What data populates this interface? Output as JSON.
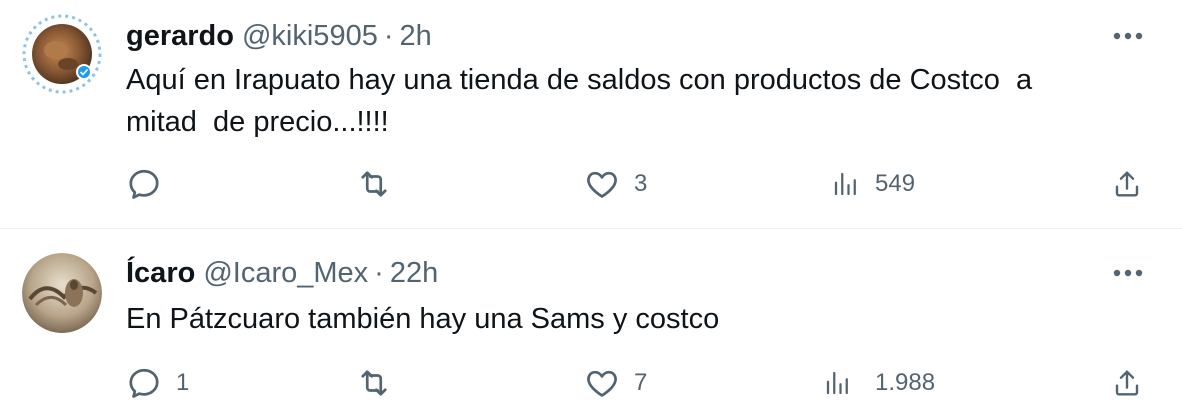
{
  "tweets": [
    {
      "display_name": "gerardo",
      "handle": "@kiki5905",
      "separator": "·",
      "time": "2h",
      "text": "Aquí en Irapuato hay una tienda de saldos con productos de Costco  a\nmitad  de precio...!!!!",
      "avatar_icon": "avatar-photo-with-story-ring",
      "actions": {
        "reply_count": "",
        "retweet_count": "",
        "like_count": "3",
        "views_count": "549"
      }
    },
    {
      "display_name": "Ícaro",
      "handle": "@Icaro_Mex",
      "separator": "·",
      "time": "22h",
      "text": "En Pátzcuaro también hay una Sams y costco",
      "avatar_icon": "avatar-photo",
      "actions": {
        "reply_count": "1",
        "retweet_count": "",
        "like_count": "7",
        "views_count": "1.988"
      }
    }
  ],
  "colors": {
    "text_primary": "#0f1419",
    "text_secondary": "#536471",
    "divider": "#eff3f4",
    "verified_accent": "#1d9bf0"
  }
}
